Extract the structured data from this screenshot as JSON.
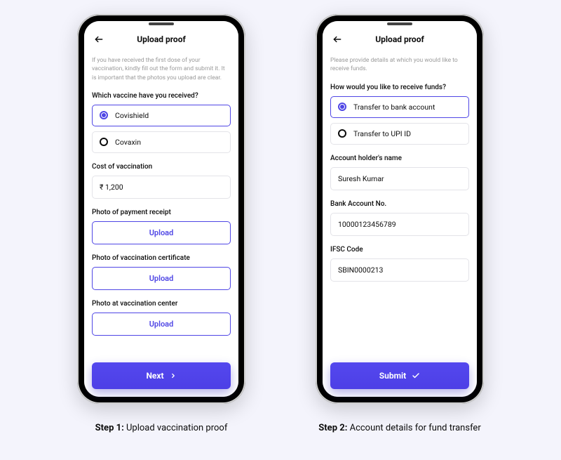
{
  "accent_color": "#4f46e5",
  "screens": {
    "left": {
      "header_title": "Upload proof",
      "intro": "If you have received the first dose of your vaccination, kindly fill out the form and submit it. It is important that the photos you upload are clear.",
      "vaccine_question": "Which vaccine have you received?",
      "vaccine_options": [
        "Covishield",
        "Covaxin"
      ],
      "cost_label": "Cost of vaccination",
      "cost_value": "₹  1,200",
      "receipt_label": "Photo of payment receipt",
      "cert_label": "Photo of vaccination certificate",
      "center_label": "Photo at vaccination center",
      "upload_label": "Upload",
      "primary_label": "Next"
    },
    "right": {
      "header_title": "Upload proof",
      "intro": "Please provide details at which you would like to receive funds.",
      "funds_question": "How would you like to receive funds?",
      "funds_options": [
        "Transfer to bank account",
        "Transfer to UPI ID"
      ],
      "holder_label": "Account holder's name",
      "holder_value": "Suresh Kumar",
      "account_label": "Bank Account No.",
      "account_value": "10000123456789",
      "ifsc_label": "IFSC Code",
      "ifsc_value": "SBIN0000213",
      "primary_label": "Submit"
    }
  },
  "captions": {
    "left_bold": "Step 1:",
    "left_rest": " Upload vaccination proof",
    "right_bold": "Step 2:",
    "right_rest": " Account details for fund transfer"
  }
}
